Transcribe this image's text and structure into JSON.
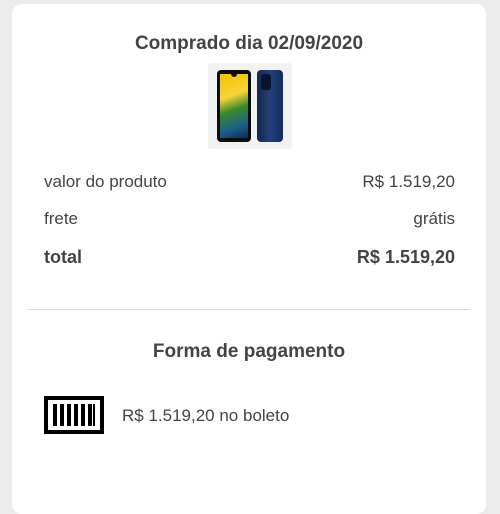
{
  "order": {
    "title": "Comprado dia 02/09/2020",
    "product_image_icon": "smartphone-product-image"
  },
  "summary": {
    "product_value_label": "valor do produto",
    "product_value": "R$ 1.519,20",
    "shipping_label": "frete",
    "shipping_value": "grátis",
    "total_label": "total",
    "total_value": "R$ 1.519,20"
  },
  "payment": {
    "title": "Forma de pagamento",
    "method_icon": "barcode-icon",
    "method_text": "R$ 1.519,20 no boleto"
  }
}
